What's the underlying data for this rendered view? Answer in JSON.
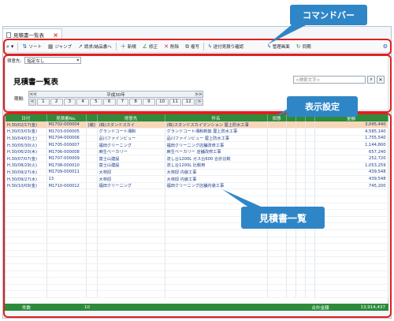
{
  "window": {
    "tab_title": "見積書一覧表",
    "tab_close": "×"
  },
  "toolbar": {
    "items": [
      {
        "icon": "search-icon",
        "label": ""
      },
      {
        "icon": "sort-icon",
        "label": "ソート"
      },
      {
        "icon": "jump-icon",
        "label": "ジャンプ"
      },
      {
        "icon": "convert-icon",
        "label": "請求/納品書へ"
      },
      {
        "icon": "plus-icon",
        "label": "新規"
      },
      {
        "icon": "edit-icon",
        "label": "修正"
      },
      {
        "icon": "delete-icon",
        "label": "削除"
      },
      {
        "icon": "copy-icon",
        "label": "複写"
      },
      {
        "icon": "bolt-icon",
        "label": "送付見積り確認"
      },
      {
        "icon": "bolt-icon",
        "label": "管理画面"
      },
      {
        "icon": "sync-icon",
        "label": "同期"
      }
    ]
  },
  "filter": {
    "label": "得意先:",
    "value": "指定なし"
  },
  "page": {
    "title": "見積書一覧表"
  },
  "search": {
    "placeholder": "<検索文字>"
  },
  "period": {
    "label": "期間:",
    "era": "平成30年",
    "prev": "<<",
    "next": ">>",
    "months": [
      "<",
      "1",
      "2",
      "3",
      "4",
      "5",
      "6",
      "7",
      "8",
      "9",
      "10",
      "11",
      "12",
      ">"
    ]
  },
  "table": {
    "columns": [
      "日付",
      "見積書No.",
      "",
      "得意先",
      "件名",
      "状態",
      "",
      "",
      "",
      "金額"
    ],
    "rows": [
      [
        "H.30/02/17(金)",
        "M1702-000004",
        "[補]",
        "(株)スタンドスカイ",
        "(株)スタンドスカイマンション 屋上防水工事",
        "",
        "",
        "",
        "",
        "3,045,440"
      ],
      [
        "H.30/03/03(金)",
        "M1703-000005",
        "",
        "グランドコート湘和",
        "グランドコート湘和新築 屋上防水工事",
        "",
        "",
        "",
        "",
        "4,585,140"
      ],
      [
        "H.30/04/03(土)",
        "M1704-000006",
        "",
        "品川ファインビュー",
        "品川ファインビュー 屋上防水工事",
        "",
        "",
        "",
        "",
        "1,755,540"
      ],
      [
        "H.30/05/30(火)",
        "M1705-000007",
        "",
        "福田クリーニング",
        "福田クリーニング店舗改修工事",
        "",
        "",
        "",
        "",
        "1,144,800"
      ],
      [
        "H.30/06/20(木)",
        "M1706-000008",
        "",
        "麻生ベーカリー",
        "麻生ベーカリー 店舗改修工事",
        "",
        "",
        "",
        "",
        "657,240"
      ],
      [
        "H.30/07/07(金)",
        "M1707-000009",
        "",
        "富士山建設",
        "流し台1200L ガス台600 合計比較",
        "",
        "",
        "",
        "",
        "252,720"
      ],
      [
        "H.30/08/29(火)",
        "M1708-000010",
        "",
        "富士山建設",
        "流し台1200L 比較用",
        "",
        "",
        "",
        "",
        "1,053,259"
      ],
      [
        "H.30/09/27(水)",
        "M1709-000011",
        "",
        "大林邸",
        "大林邸 内装工事",
        "",
        "",
        "",
        "",
        "439,548"
      ],
      [
        "H.30/09/27(水)",
        "13",
        "",
        "大林邸",
        "大林邸 内装工事",
        "",
        "",
        "",
        "",
        "439,548"
      ],
      [
        "H.30/10/09(金)",
        "M1710-000012",
        "",
        "福田クリーニング",
        "福田クリーニング店舗内装工事",
        "",
        "",
        "",
        "",
        "745,200"
      ]
    ]
  },
  "footer": {
    "count_label": "件数",
    "count": "10",
    "total_label": "合計金額",
    "total": "13,914,437"
  },
  "annotations": {
    "command_bar": "コマンドバー",
    "display_settings": "表示設定",
    "list": "見積書一覧"
  },
  "colors": {
    "header_green": "#2e8b3c",
    "callout_red": "#e02020",
    "bubble_blue": "#2f86c7",
    "selected_row": "#f8d6b8"
  }
}
